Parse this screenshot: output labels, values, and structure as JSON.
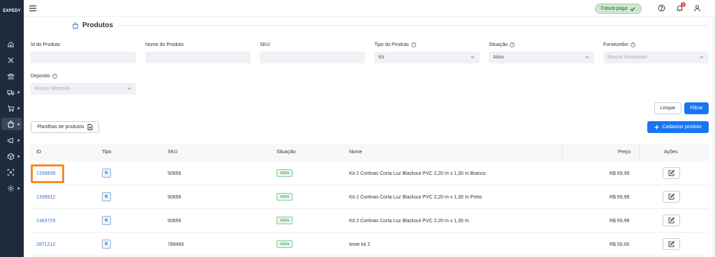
{
  "app": {
    "logo_text": "EXPEDY"
  },
  "sidebar": {
    "items": [
      {
        "icon": "home-icon",
        "has_arrow": false
      },
      {
        "icon": "hub-icon",
        "has_arrow": false
      },
      {
        "icon": "bank-icon",
        "has_arrow": false
      },
      {
        "icon": "truck-icon",
        "has_arrow": true
      },
      {
        "icon": "cart-icon",
        "has_arrow": true
      },
      {
        "icon": "bag-icon",
        "has_arrow": true,
        "active": true
      },
      {
        "icon": "megaphone-icon",
        "has_arrow": true
      },
      {
        "icon": "box-icon",
        "has_arrow": true
      },
      {
        "icon": "scan-icon",
        "has_arrow": false
      },
      {
        "icon": "gear-icon",
        "has_arrow": true
      }
    ]
  },
  "topbar": {
    "badge_label": "Fatura paga",
    "notifications_count": "2"
  },
  "page": {
    "title": "Produtos"
  },
  "filters": {
    "id_label": "Id do Produto",
    "id_value": "",
    "name_label": "Nome do Produto",
    "name_value": "",
    "sku_label": "SKU",
    "sku_value": "",
    "type_label": "Tipo do Produto",
    "type_value": "Kit",
    "status_label": "Situação",
    "status_value": "Ativo",
    "supplier_label": "Fornecedor",
    "supplier_placeholder": "Buscar fornecedor",
    "deposit_label": "Deposito",
    "deposit_placeholder": "Buscar deposito",
    "clear_label": "Limpar",
    "filter_label": "Filtrar"
  },
  "actions": {
    "spreadsheets_label": "Planilhas de produtos",
    "add_product_label": "Cadastrar produto"
  },
  "table": {
    "headers": {
      "id": "ID",
      "type": "Tipo",
      "sku": "SKU",
      "status": "Situação",
      "name": "Nome",
      "price": "Preço",
      "actions": "Ações"
    },
    "rows": [
      {
        "id": "1339839",
        "type": "K",
        "sku": "50656",
        "status": "Ativo",
        "name": "Kit 2 Cortinas Corta Luz Blackout PVC 2,20 m x 1,30 m Branco",
        "price": "R$ 69,99"
      },
      {
        "id": "1339912",
        "type": "K",
        "sku": "50656",
        "status": "Ativo",
        "name": "Kit 2 Cortinas Corta Luz Blackout PVC 2,20 m x 1,30 m Preto",
        "price": "R$ 69,99"
      },
      {
        "id": "1363729",
        "type": "K",
        "sku": "50656",
        "status": "Ativo",
        "name": "Kit 2 Cortinas Corta Luz Blackout PVC 2,20 m x 1,30 m",
        "price": "R$ 69,99"
      },
      {
        "id": "2871212",
        "type": "K",
        "sku": "789465",
        "status": "Ativo",
        "name": "teste kit 2",
        "price": "R$ 50,00"
      }
    ]
  }
}
